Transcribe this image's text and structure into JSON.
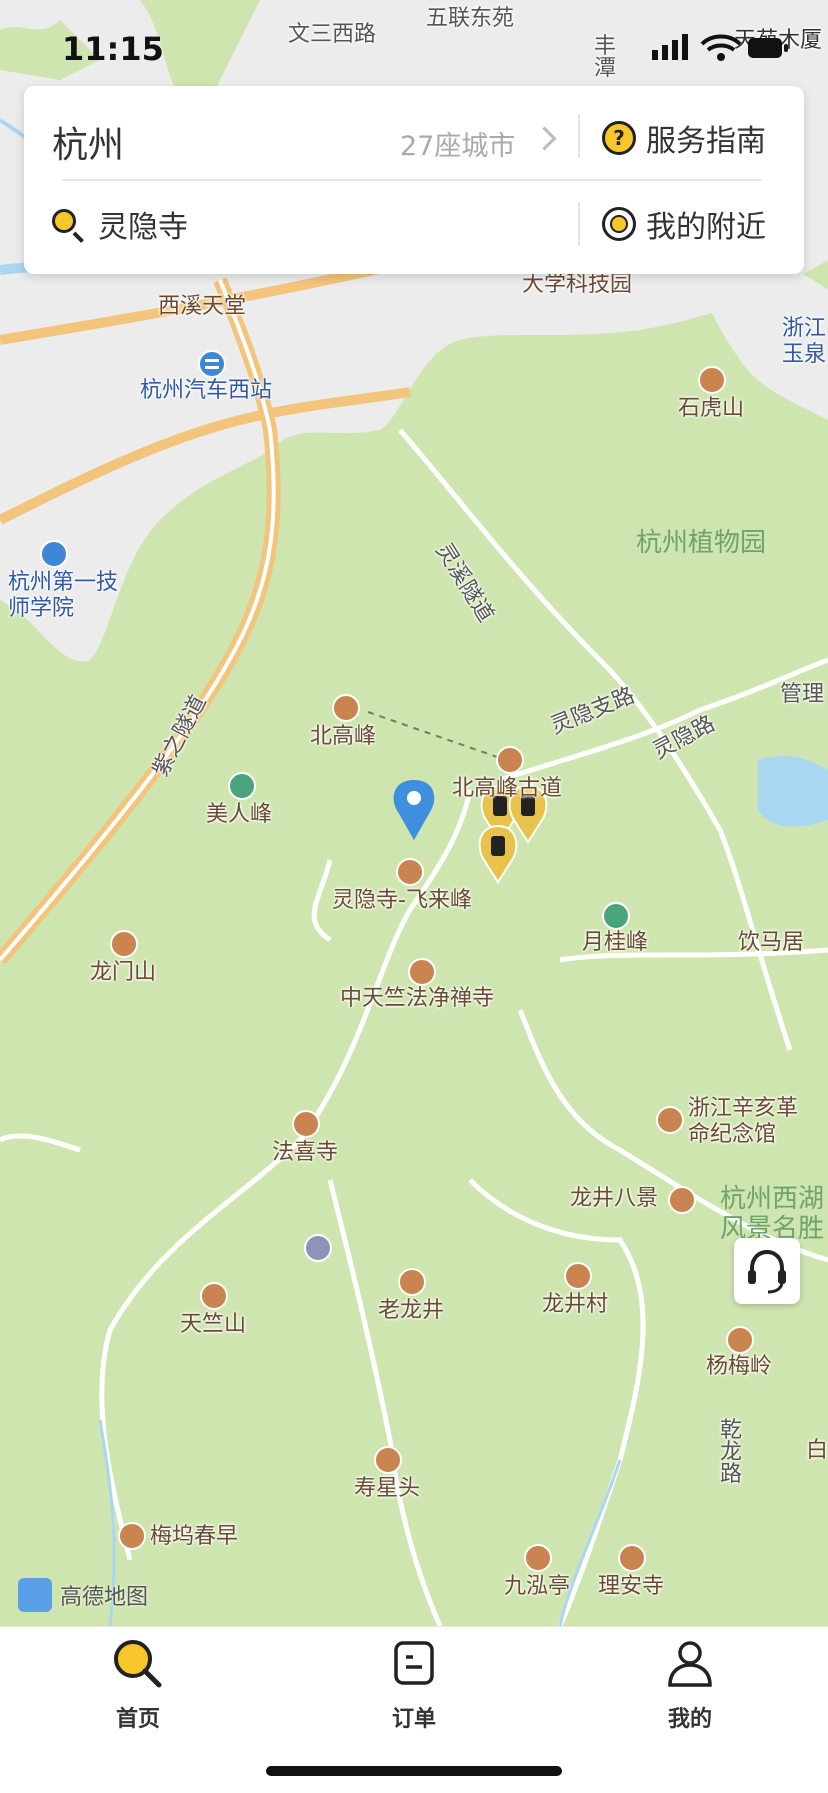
{
  "status_bar": {
    "time": "11:15"
  },
  "header": {
    "city": "杭州",
    "city_count": "27座城市",
    "service_guide": "服务指南",
    "search_text": "灵隐寺",
    "nearby": "我的附近"
  },
  "map": {
    "labels": {
      "wensan": "文三西路",
      "wulian": "五联东苑",
      "fengtan": "丰潭",
      "tianyuan": "天苑木厦",
      "xixi": "西溪天堂",
      "daxue": "大学科技园",
      "bus": "杭州汽车西站",
      "zhejiang": "浙江",
      "yuquan": "玉泉",
      "shihu": "石虎山",
      "lingxi": "灵溪隧道",
      "zhiwu": "杭州植物园",
      "jishi": "杭州第一技师学院",
      "zizhi": "紫之隧道",
      "beigao": "北高峰",
      "lingzhi": "灵隐支路",
      "lingyin_road": "灵隐路",
      "guanli": "管理",
      "beigao_road": "北高峰古道",
      "meiren": "美人峰",
      "feilai": "灵隐寺-飞来峰",
      "yuegui": "月桂峰",
      "yinma": "饮马居",
      "longmen": "龙门山",
      "zhongtianzhu": "中天竺法净禅寺",
      "faxi": "法喜寺",
      "xinhai": "浙江辛亥革命纪念馆",
      "longjing8": "龙井八景",
      "xihu": "杭州西湖风景名胜",
      "laolongjing": "老龙井",
      "longjingcun": "龙井村",
      "tianzhu": "天竺山",
      "yangmei": "杨梅岭",
      "qianlong": "乾龙路",
      "shouxing": "寿星头",
      "meiwu": "梅坞春早",
      "jiuhong": "九泓亭",
      "lian": "理安寺",
      "bai": "白"
    },
    "attribution": "高德地图",
    "colors": {
      "park": "#cfe5b0",
      "urban": "#ececec",
      "road_major": "#f3c47b",
      "pin": "#3e8fde",
      "marker": "#e8c24a"
    }
  },
  "tabs": [
    {
      "label": "首页",
      "icon": "search-icon",
      "active": true
    },
    {
      "label": "订单",
      "icon": "order-icon",
      "active": false
    },
    {
      "label": "我的",
      "icon": "user-icon",
      "active": false
    }
  ]
}
